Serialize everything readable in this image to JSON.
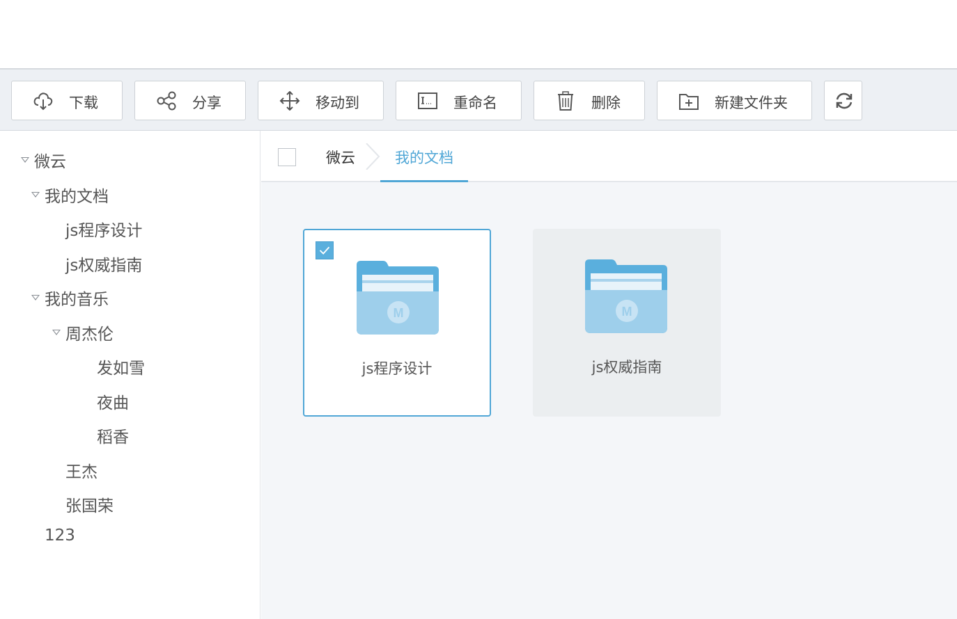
{
  "toolbar": {
    "buttons": [
      {
        "label": "下载",
        "icon": "cloud-download-icon"
      },
      {
        "label": "分享",
        "icon": "share-icon"
      },
      {
        "label": "移动到",
        "icon": "move-icon"
      },
      {
        "label": "重命名",
        "icon": "rename-icon"
      },
      {
        "label": "删除",
        "icon": "trash-icon"
      },
      {
        "label": "新建文件夹",
        "icon": "new-folder-icon"
      }
    ],
    "refresh_icon": "refresh-icon"
  },
  "tree": {
    "items": [
      {
        "label": "微云",
        "expanded": true
      },
      {
        "label": "我的文档",
        "expanded": true
      },
      {
        "label": "js程序设计"
      },
      {
        "label": "js权威指南"
      },
      {
        "label": "我的音乐",
        "expanded": true
      },
      {
        "label": "周杰伦",
        "expanded": true
      },
      {
        "label": "发如雪"
      },
      {
        "label": "夜曲"
      },
      {
        "label": "稻香"
      },
      {
        "label": "王杰"
      },
      {
        "label": "张国荣"
      },
      {
        "label": "123"
      }
    ]
  },
  "breadcrumb": {
    "root": "微云",
    "current": "我的文档"
  },
  "files": [
    {
      "name": "js程序设计",
      "selected": true
    },
    {
      "name": "js权威指南",
      "selected": false
    }
  ],
  "colors": {
    "accent": "#4fa6d6",
    "folder": "#5aafdd",
    "toolbar_bg": "#edf0f4",
    "main_bg": "#f4f6f9"
  }
}
